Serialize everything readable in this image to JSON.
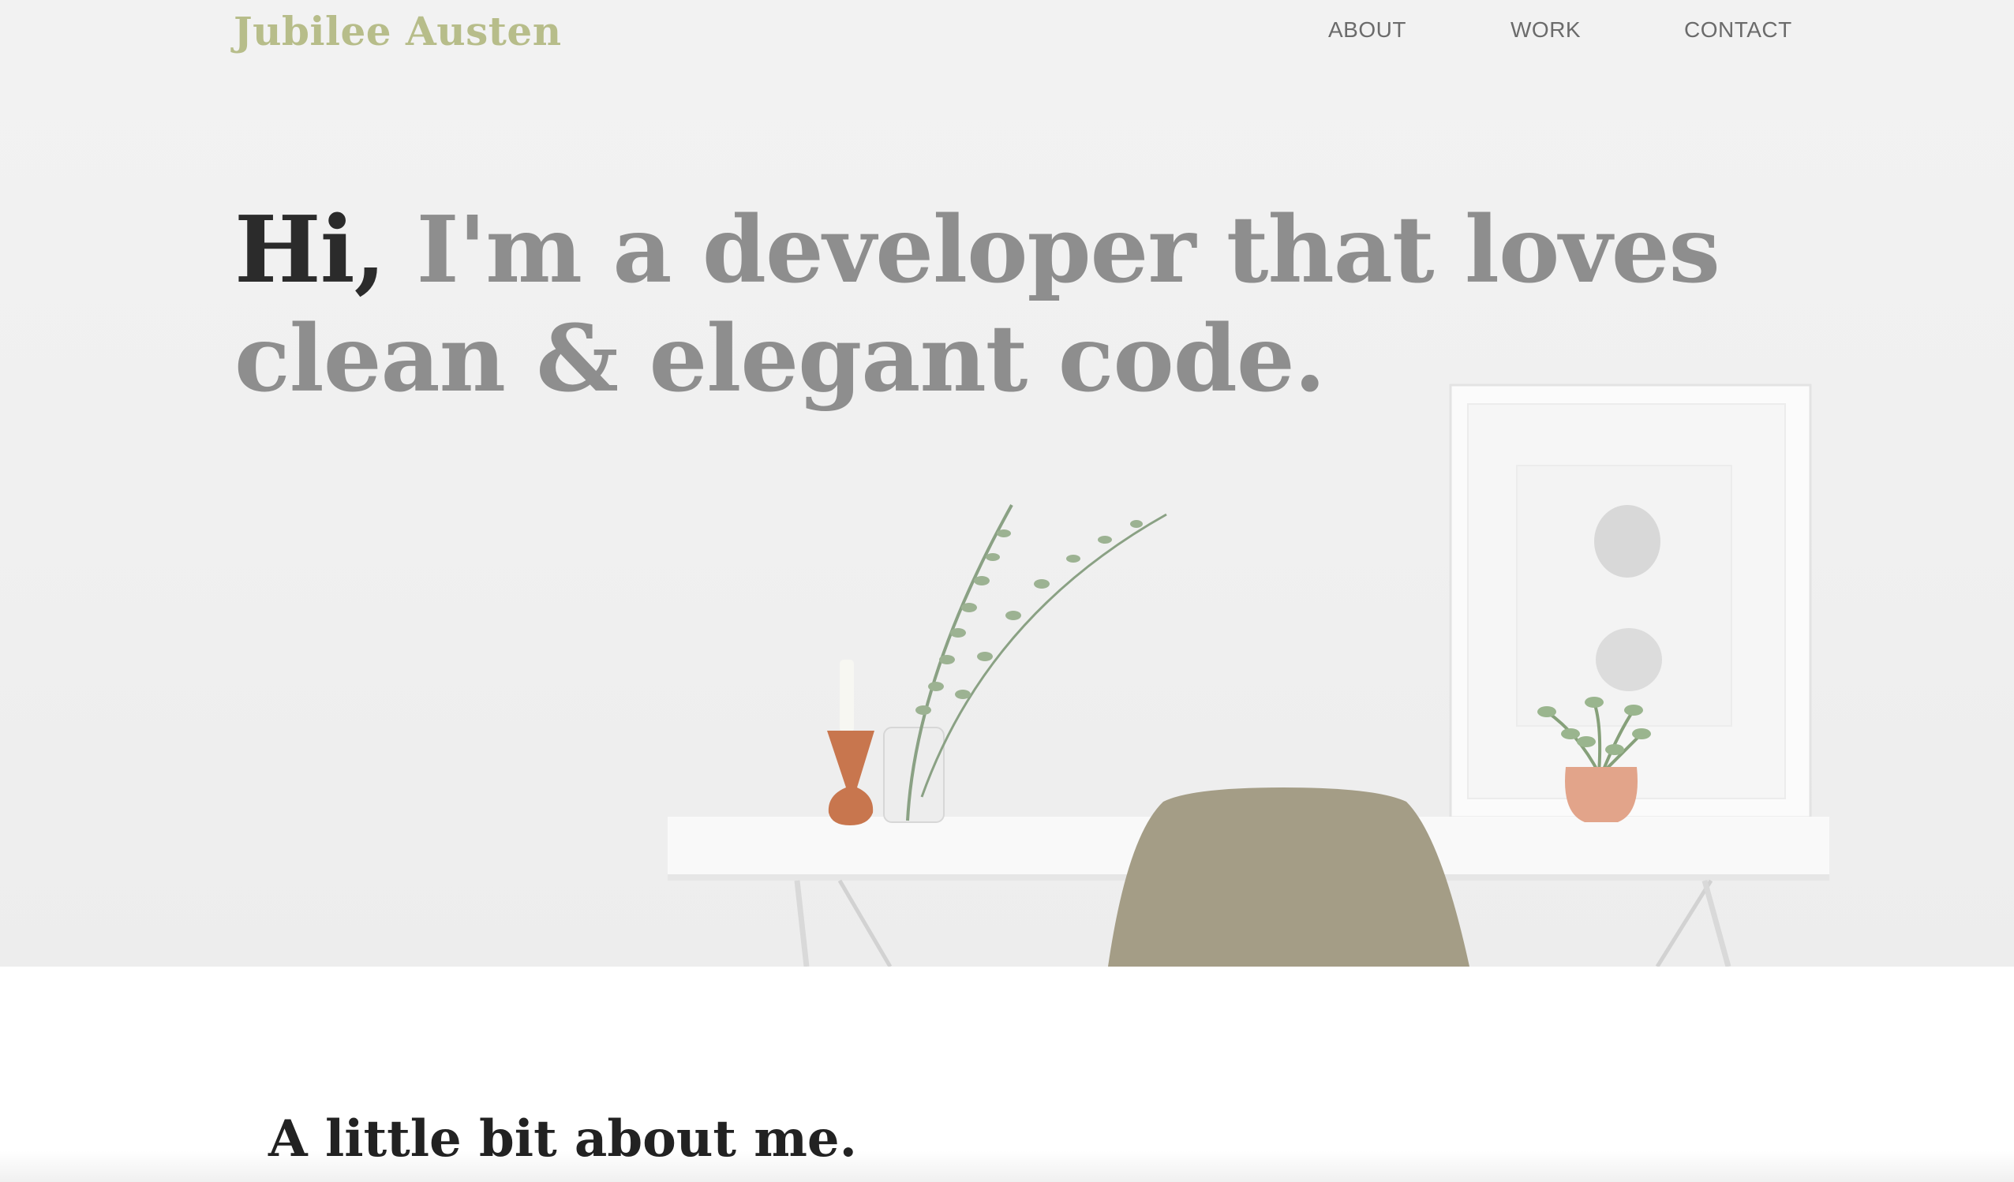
{
  "header": {
    "brand": "Jubilee Austen",
    "nav": [
      {
        "label": "ABOUT"
      },
      {
        "label": "WORK"
      },
      {
        "label": "CONTACT"
      }
    ]
  },
  "hero": {
    "greeting": "Hi,",
    "headline_line1": " I'm a developer that loves",
    "headline_line2": "clean & elegant code."
  },
  "about": {
    "title": "A little bit about me."
  },
  "colors": {
    "brand": "#b7bd8a",
    "nav_text": "#6b6b6b",
    "headline_muted": "#8e8e8e",
    "headline_dark": "#2b2b2b",
    "chair": "#a49d86"
  }
}
